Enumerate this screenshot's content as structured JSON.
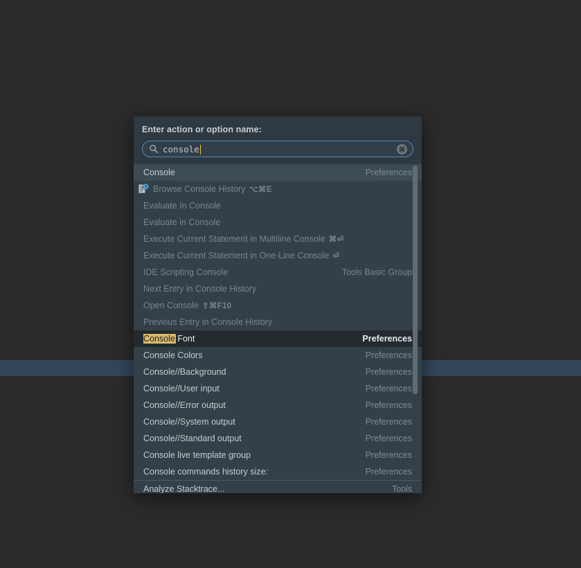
{
  "background": {
    "canvas_color": "#2b2b2b",
    "highlight_line_color": "#34465c"
  },
  "dialog": {
    "title": "Enter action or option name:",
    "search": {
      "value": "console",
      "icon": "search-icon",
      "clear_icon": "clear-circle-icon",
      "caret_color": "#f2c12e",
      "border_color": "#5b86b8"
    },
    "theme": {
      "header_bg": "#2e3942",
      "list_bg": "#334048",
      "selected_bg": "#232b2f",
      "hover_bg": "#3d4b53",
      "match_highlight": "#d9b96a",
      "enabled_text": "#c4cbd0",
      "disabled_text": "#76868f",
      "group_text": "#7f8c93"
    },
    "results": [
      {
        "label": "Console",
        "group": "Preferences",
        "state": "hover",
        "enabled": true,
        "icon": null,
        "shortcut": "",
        "match": "Console"
      },
      {
        "label": "Browse Console History",
        "group": "",
        "state": "normal",
        "enabled": false,
        "icon": "console-history-icon",
        "shortcut": "⌥⌘E",
        "match": ""
      },
      {
        "label": "Evaluate In Console",
        "group": "",
        "state": "normal",
        "enabled": false,
        "icon": null,
        "shortcut": "",
        "match": ""
      },
      {
        "label": "Evaluate in Console",
        "group": "",
        "state": "normal",
        "enabled": false,
        "icon": null,
        "shortcut": "",
        "match": ""
      },
      {
        "label": "Execute Current Statement in Multiline Console",
        "group": "",
        "state": "normal",
        "enabled": false,
        "icon": null,
        "shortcut": "⌘⏎",
        "match": ""
      },
      {
        "label": "Execute Current Statement in One-Line Console",
        "group": "",
        "state": "normal",
        "enabled": false,
        "icon": null,
        "shortcut": "⏎",
        "match": ""
      },
      {
        "label": "IDE Scripting Console",
        "group": "Tools Basic Group",
        "state": "normal",
        "enabled": false,
        "icon": null,
        "shortcut": "",
        "match": ""
      },
      {
        "label": "Next Entry in Console History",
        "group": "",
        "state": "normal",
        "enabled": false,
        "icon": null,
        "shortcut": "",
        "match": ""
      },
      {
        "label": "Open Console",
        "group": "",
        "state": "normal",
        "enabled": false,
        "icon": null,
        "shortcut": "⇧⌘F10",
        "match": ""
      },
      {
        "label": "Previous Entry in Console History",
        "group": "",
        "state": "normal",
        "enabled": false,
        "icon": null,
        "shortcut": "",
        "match": ""
      },
      {
        "label": "Console Font",
        "group": "Preferences",
        "state": "selected",
        "enabled": true,
        "icon": null,
        "shortcut": "",
        "match": "Console"
      },
      {
        "label": "Console Colors",
        "group": "Preferences",
        "state": "normal",
        "enabled": true,
        "icon": null,
        "shortcut": "",
        "match": ""
      },
      {
        "label": "Console//Background",
        "group": "Preferences",
        "state": "normal",
        "enabled": true,
        "icon": null,
        "shortcut": "",
        "match": ""
      },
      {
        "label": "Console//User input",
        "group": "Preferences",
        "state": "normal",
        "enabled": true,
        "icon": null,
        "shortcut": "",
        "match": ""
      },
      {
        "label": "Console//Error output",
        "group": "Preferences",
        "state": "normal",
        "enabled": true,
        "icon": null,
        "shortcut": "",
        "match": ""
      },
      {
        "label": "Console//System output",
        "group": "Preferences",
        "state": "normal",
        "enabled": true,
        "icon": null,
        "shortcut": "",
        "match": ""
      },
      {
        "label": "Console//Standard output",
        "group": "Preferences",
        "state": "normal",
        "enabled": true,
        "icon": null,
        "shortcut": "",
        "match": ""
      },
      {
        "label": "Console live template group",
        "group": "Preferences",
        "state": "normal",
        "enabled": true,
        "icon": null,
        "shortcut": "",
        "match": ""
      },
      {
        "label": "Console commands history size:",
        "group": "Preferences",
        "state": "normal",
        "enabled": true,
        "icon": null,
        "shortcut": "",
        "match": ""
      },
      {
        "label": "Analyze Stacktrace...",
        "group": "Tools",
        "state": "normal",
        "enabled": true,
        "icon": null,
        "shortcut": "",
        "match": "",
        "separator_above": true
      }
    ],
    "scrollbar": {
      "name": "results-scrollbar",
      "thumb_color": "#5c6d76"
    }
  }
}
